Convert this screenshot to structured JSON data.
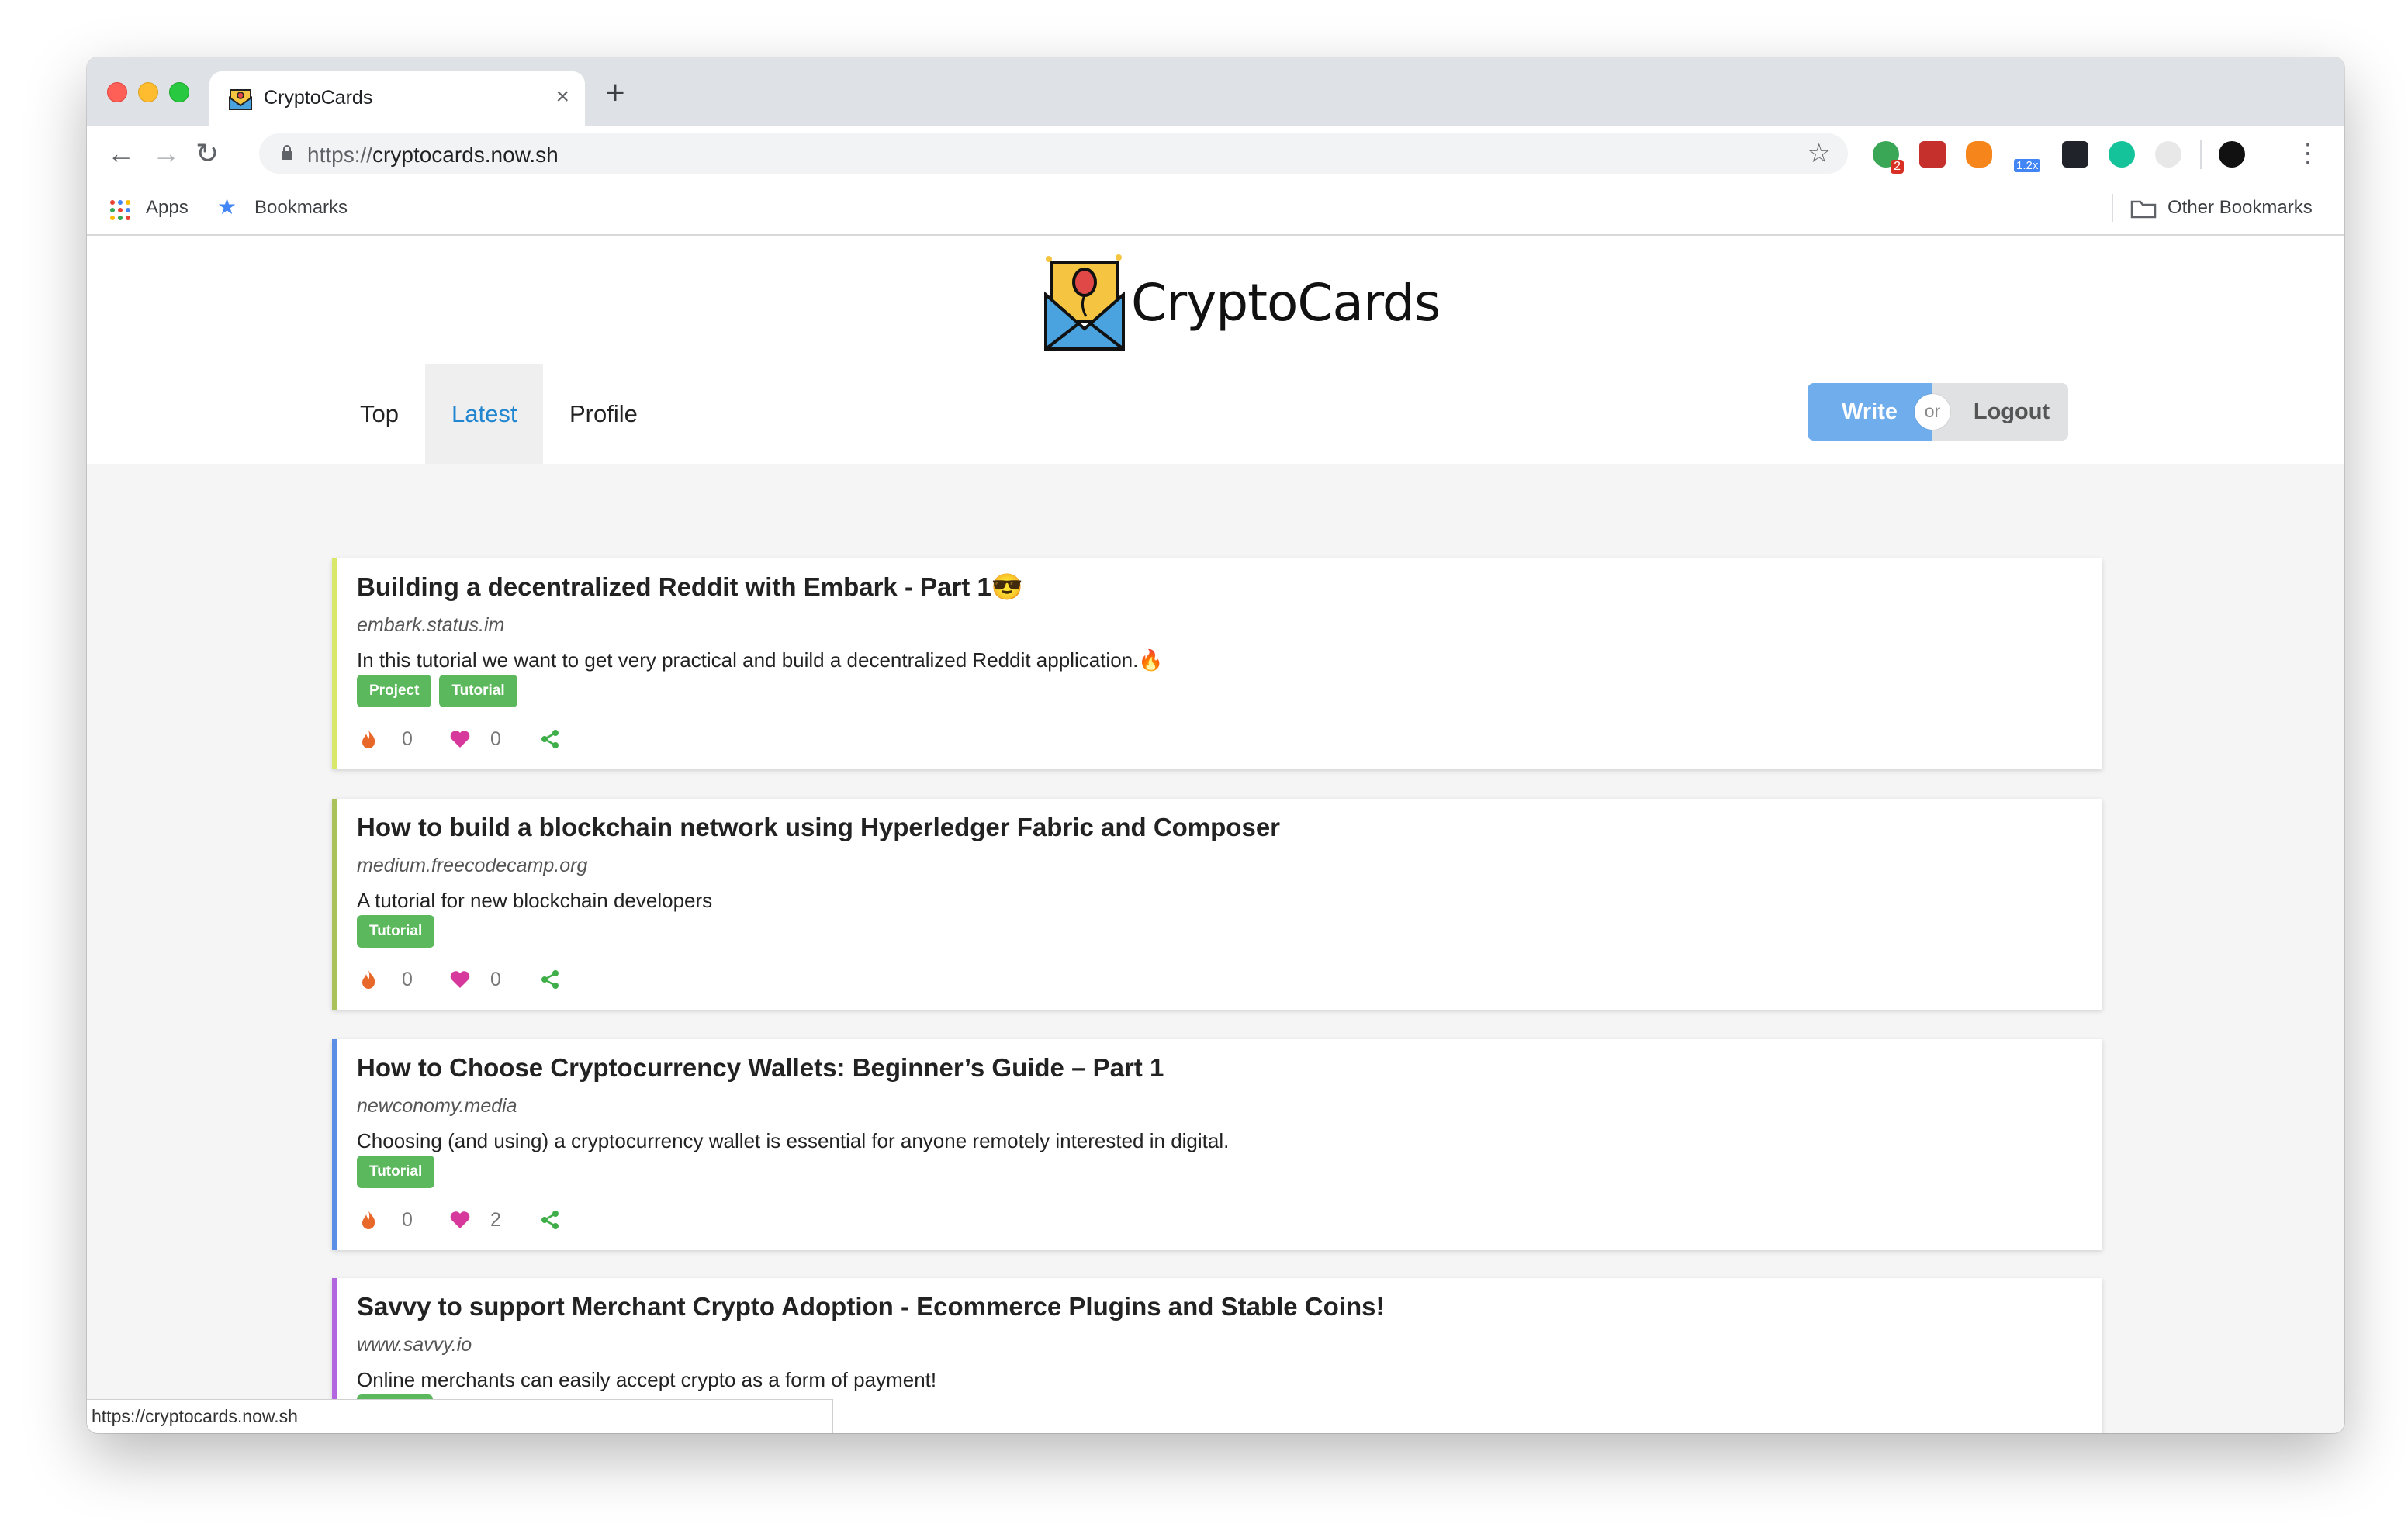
{
  "browser": {
    "tab_title": "CryptoCards",
    "tab_close": "×",
    "new_tab": "+",
    "back": "←",
    "forward": "→",
    "reload": "↻",
    "url_scheme": "https://",
    "url_host": "cryptocards.now.sh",
    "bookmark_star": "☆",
    "menu": "⋮",
    "extension_badge_count": "2",
    "extension_zoom_label": "1.2x",
    "status_url": "https://cryptocards.now.sh"
  },
  "bookmarks_bar": {
    "apps_label": "Apps",
    "bookmarks_label": "Bookmarks",
    "other_bookmarks_label": "Other Bookmarks"
  },
  "site": {
    "logo_text": "CryptoCards",
    "nav": [
      "Top",
      "Latest",
      "Profile"
    ],
    "active_nav": "Latest",
    "write_label": "Write",
    "or_label": "or",
    "logout_label": "Logout"
  },
  "cards": [
    {
      "title": "Building a decentralized Reddit with Embark - Part 1😎",
      "source": "embark.status.im",
      "description": "In this tutorial we want to get very practical and build a decentralized Reddit application.🔥",
      "tags": [
        "Project",
        "Tutorial"
      ],
      "fire_count": "0",
      "like_count": "0",
      "border_color": "#d9e76a"
    },
    {
      "title": "How to build a blockchain network using Hyperledger Fabric and Composer",
      "source": "medium.freecodecamp.org",
      "description": "A tutorial for new blockchain developers",
      "tags": [
        "Tutorial"
      ],
      "fire_count": "0",
      "like_count": "0",
      "border_color": "#a9c25a"
    },
    {
      "title": "How to Choose Cryptocurrency Wallets: Beginner’s Guide – Part 1",
      "source": "newconomy.media",
      "description": "Choosing (and using) a cryptocurrency wallet is essential for anyone remotely interested in digital.",
      "tags": [
        "Tutorial"
      ],
      "fire_count": "0",
      "like_count": "2",
      "border_color": "#5b8ee6"
    },
    {
      "title": "Savvy to support Merchant Crypto Adoption - Ecommerce Plugins and Stable Coins!",
      "source": "www.savvy.io",
      "description": "Online merchants can easily accept crypto as a form of payment!",
      "tags": [],
      "fire_count": "",
      "like_count": "",
      "border_color": "#b266e0"
    }
  ],
  "colors": {
    "accent_blue": "#2185d0",
    "write_button": "#6fadec",
    "tag_green": "#5cb85c",
    "fire_orange": "#e8682a",
    "heart_pink": "#d6399b",
    "share_green": "#3fae49"
  },
  "icons": {
    "fire": "fire-icon",
    "heart": "heart-icon",
    "share": "share-icon"
  }
}
